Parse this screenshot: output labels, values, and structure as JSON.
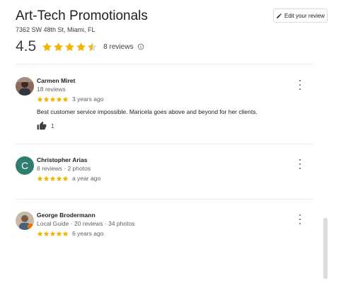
{
  "business": {
    "name": "Art-Tech Promotionals",
    "address": "7362 SW 48th St, Miami, FL",
    "rating": "4.5",
    "review_count": "8 reviews",
    "edit_review_label": "Edit your review"
  },
  "colors": {
    "star": "#f4b400",
    "star_empty": "#dadce0",
    "avatar_c": "#2e7d6f"
  },
  "reviews": [
    {
      "name": "Carmen Miret",
      "meta": "18 reviews",
      "stars": 5,
      "time": "3 years ago",
      "text": "Best customer service impossible. Maricela goes above and beyond for her clients.",
      "likes": "1"
    },
    {
      "name": "Christopher Arias",
      "meta": "8 reviews · 2 photos",
      "avatar_letter": "C",
      "stars": 5,
      "time": "a year ago"
    },
    {
      "name": "George Brodermann",
      "meta": "Local Guide · 20 reviews · 34 photos",
      "stars": 5,
      "time": "6 years ago"
    }
  ]
}
